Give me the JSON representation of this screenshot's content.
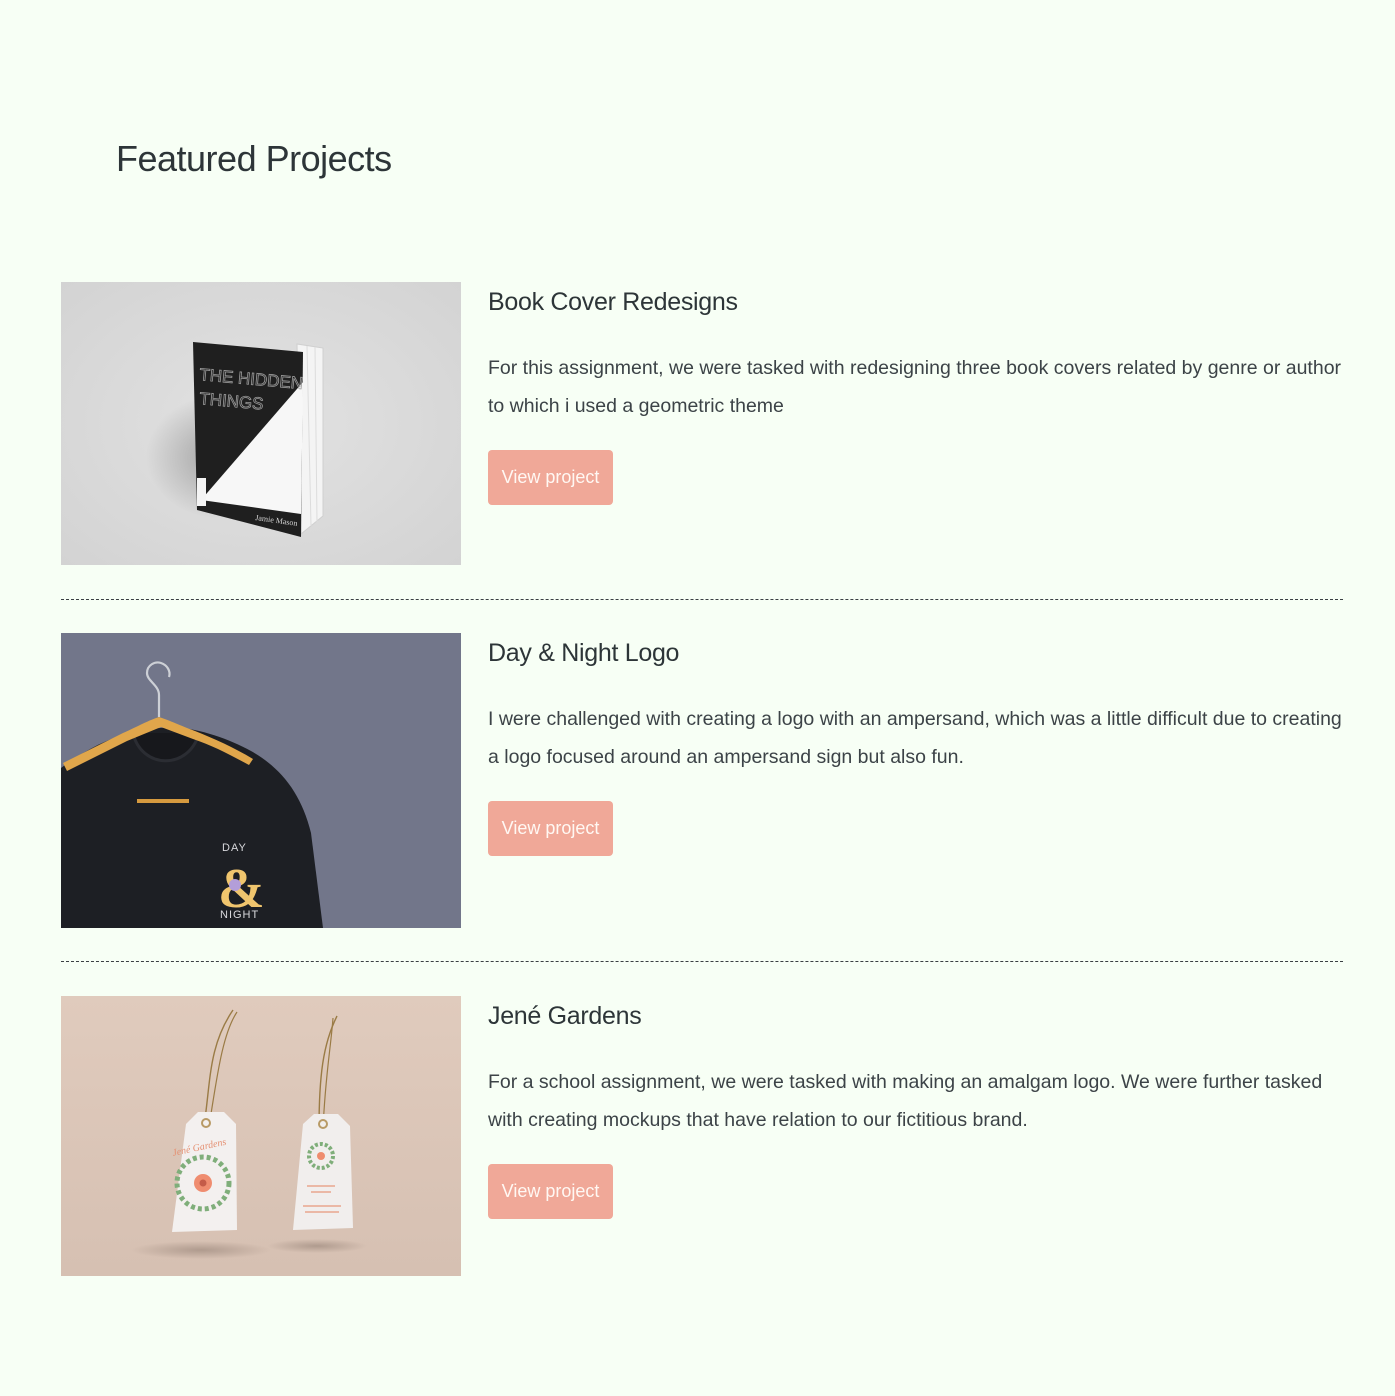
{
  "page": {
    "title": "Featured Projects"
  },
  "projects": [
    {
      "title": "Book Cover Redesigns",
      "description": "For this assignment, we were tasked with redesigning three book covers related by genre or author to which i used a geometric theme",
      "button_label": "View project",
      "image": {
        "book_title_line1": "THE HIDDEN",
        "book_title_line2": "THINGS",
        "book_author": "Jamie Mason"
      }
    },
    {
      "title": "Day & Night Logo",
      "description": "I were challenged with creating a logo with an ampersand, which was a little difficult due to creating a logo focused around an ampersand sign but also fun.",
      "button_label": "View project",
      "image": {
        "logo_top": "DAY",
        "logo_mark": "&",
        "logo_bottom": "NIGHT"
      }
    },
    {
      "title": "Jené Gardens",
      "description": "For a school assignment, we were tasked with making an amalgam logo. We were further tasked with creating mockups that have relation to our fictitious brand.",
      "button_label": "View project",
      "image": {
        "tag_brand": "Jené Gardens"
      }
    }
  ],
  "colors": {
    "background": "#f7fff5",
    "button": "#f0a898",
    "heading": "#2d3538"
  }
}
